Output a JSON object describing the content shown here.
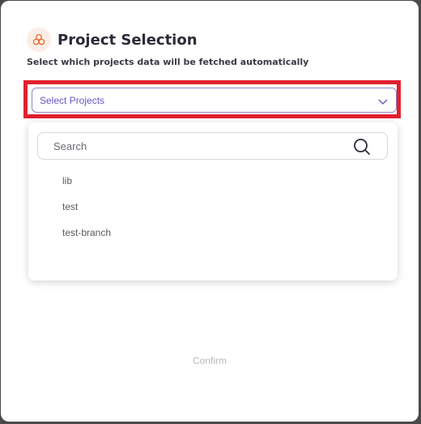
{
  "dialog": {
    "title": "Project Selection",
    "subtitle": "Select which projects data will be fetched automatically",
    "logo_icon": "cluster-circles-icon",
    "accent_color": "#6a55c4",
    "highlight_color": "#e0212e"
  },
  "select": {
    "placeholder": "Select Projects",
    "icon": "chevron-down-icon"
  },
  "dropdown": {
    "search_placeholder": "Search",
    "search_icon": "search-icon",
    "options": [
      "lib",
      "test",
      "test-branch"
    ]
  },
  "footer": {
    "confirm_label": "Confirm"
  }
}
